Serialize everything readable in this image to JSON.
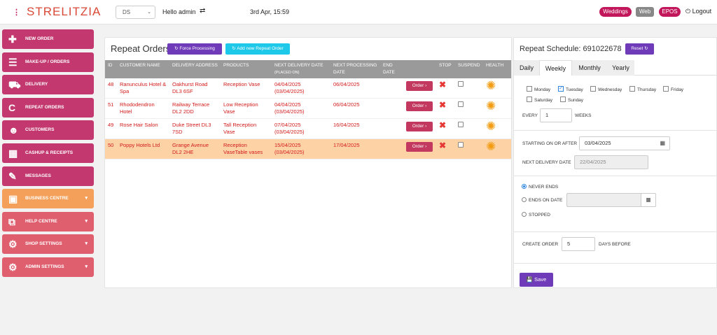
{
  "header": {
    "menu_icon": "kebab-icon",
    "logo_text": "STRELITZIA",
    "store_select": "DS",
    "greeting": "Hello admin",
    "datetime": "3rd Apr, 15:59",
    "pills": [
      "Weddings",
      "Web",
      "EPOS"
    ],
    "logout_label": "Logout"
  },
  "sidebar": {
    "items": [
      {
        "label": "NEW ORDER",
        "icon": "plus-icon"
      },
      {
        "label": "MAKE-UP / ORDERS",
        "icon": "list-icon"
      },
      {
        "label": "DELIVERY",
        "icon": "truck-icon"
      },
      {
        "label": "REPEAT ORDERS",
        "icon": "repeat-icon"
      },
      {
        "label": "CUSTOMERS",
        "icon": "users-icon"
      },
      {
        "label": "CASHUP & RECEIPTS",
        "icon": "calculator-icon"
      },
      {
        "label": "MESSAGES",
        "icon": "edit-icon"
      },
      {
        "label": "BUSINESS CENTRE",
        "icon": "briefcase-icon"
      },
      {
        "label": "HELP CENTRE",
        "icon": "external-link-icon"
      },
      {
        "label": "SHOP SETTINGS",
        "icon": "gear-icon"
      },
      {
        "label": "ADMIN SETTINGS",
        "icon": "gear-icon"
      }
    ]
  },
  "repeat_orders": {
    "title": "Repeat Orders",
    "force_label": "Force Processing",
    "add_label": "Add new Repeat Order",
    "columns": [
      "ID",
      "CUSTOMER NAME",
      "DELIVERY ADDRESS",
      "PRODUCTS",
      "NEXT DELIVERY DATE",
      "(PLACED ON)",
      "NEXT PROCESSING DATE",
      "END DATE",
      "",
      "STOP",
      "SUSPEND",
      "HEALTH"
    ],
    "order_label": "Order",
    "rows": [
      {
        "id": "48",
        "customer": "Ranunculus Hotel & Spa",
        "address": "Oakhurst Road DL3 6SF",
        "products": "Reception Vase",
        "next_delivery": "04/04/2025",
        "placed_on": "(03/04/2025)",
        "next_processing": "06/04/2025",
        "end_date": ""
      },
      {
        "id": "51",
        "customer": "Rhododendron Hotel",
        "address": "Railway Terrace DL2 2DD",
        "products": "Low Reception Vase",
        "next_delivery": "04/04/2025",
        "placed_on": "(03/04/2025)",
        "next_processing": "06/04/2025",
        "end_date": ""
      },
      {
        "id": "49",
        "customer": "Rose Hair Salon",
        "address": "Duke Street DL3 7SD",
        "products": "Tall Reception Vase",
        "next_delivery": "07/04/2025",
        "placed_on": "(03/04/2025)",
        "next_processing": "16/04/2025",
        "end_date": ""
      },
      {
        "id": "50",
        "customer": "Poppy Hotels Ltd",
        "address": "Grange Avenue DL2 2HE",
        "products": "Reception VaseTable vases",
        "next_delivery": "15/04/2025",
        "placed_on": "(03/04/2025)",
        "next_processing": "17/04/2025",
        "end_date": ""
      }
    ]
  },
  "schedule": {
    "title": "Repeat Schedule: 691022678",
    "reset_label": "Reset",
    "tabs": [
      "Daily",
      "Weekly",
      "Monthly",
      "Yearly"
    ],
    "active_tab": "Weekly",
    "days": [
      "Monday",
      "Tuesday",
      "Wednesday",
      "Thursday",
      "Friday",
      "Saturday",
      "Sunday"
    ],
    "checked_days": [
      "Tuesday"
    ],
    "every_label": "EVERY",
    "every_value": "1",
    "weeks_label": "WEEKS",
    "starting_label": "STARTING ON OR AFTER",
    "starting_value": "03/04/2025",
    "next_delivery_label": "NEXT DELIVERY DATE",
    "next_delivery_value": "22/04/2025",
    "never_ends_label": "NEVER ENDS",
    "ends_on_label": "ENDS ON DATE",
    "stopped_label": "STOPPED",
    "selected_end": "NEVER ENDS",
    "create_label": "CREATE ORDER",
    "create_value": "5",
    "days_before_label": "DAYS BEFORE",
    "save_label": "Save"
  }
}
